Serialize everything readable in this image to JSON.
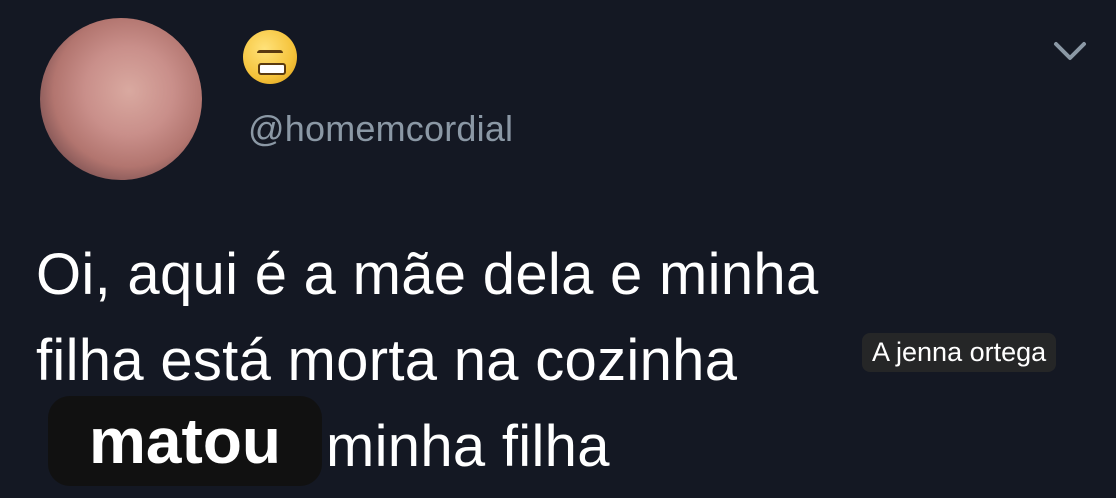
{
  "profile": {
    "handle": "@homemcordial",
    "emoji_icon": "angry-face-icon"
  },
  "tweet": {
    "lines": [
      "Oi, aqui é a mãe dela e minha",
      "filha está morta na cozinha",
      "minha filha"
    ]
  },
  "overlays": {
    "label": "A jenna ortega",
    "caption": "matou"
  },
  "colors": {
    "background": "#141823",
    "handle": "#8b98a5",
    "text": "#ffffff"
  }
}
